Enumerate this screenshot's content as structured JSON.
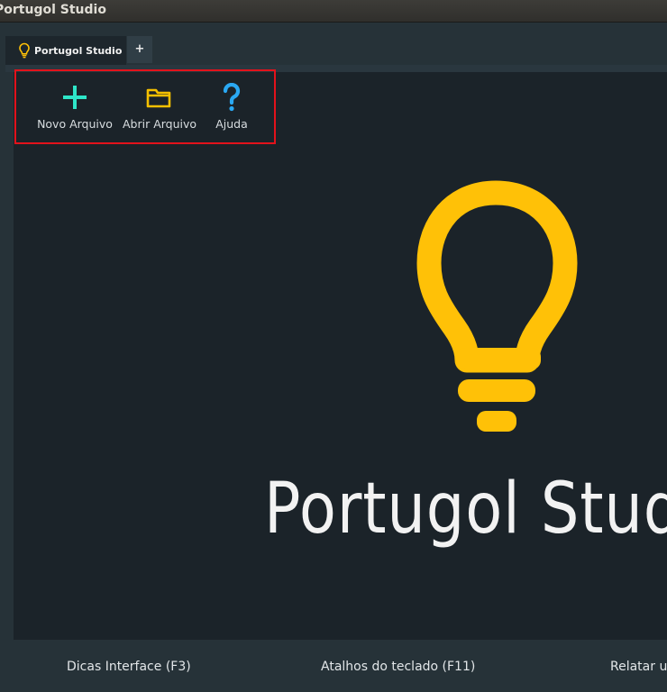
{
  "window": {
    "title": "Portugol Studio"
  },
  "tabs": [
    {
      "label": "Portugol Studio",
      "icon": "lightbulb-icon"
    }
  ],
  "tab_add_label": "+",
  "toolbar": {
    "new_file": {
      "label": "Novo Arquivo",
      "icon": "plus-icon",
      "color": "#2ee6c8"
    },
    "open_file": {
      "label": "Abrir Arquivo",
      "icon": "folder-icon",
      "color": "#f5c000"
    },
    "help": {
      "label": "Ajuda",
      "icon": "question-icon",
      "color": "#2aa8f2"
    }
  },
  "brand": {
    "text": "Portugol Studio",
    "logo": "lightbulb-logo",
    "logo_color": "#ffc107"
  },
  "statusbar": {
    "items": [
      "Dicas Interface (F3)",
      "Atalhos do teclado (F11)",
      "Relatar um bug"
    ]
  },
  "colors": {
    "background": "#263238",
    "panel": "#1b2329",
    "highlight_border": "#e3121b"
  }
}
